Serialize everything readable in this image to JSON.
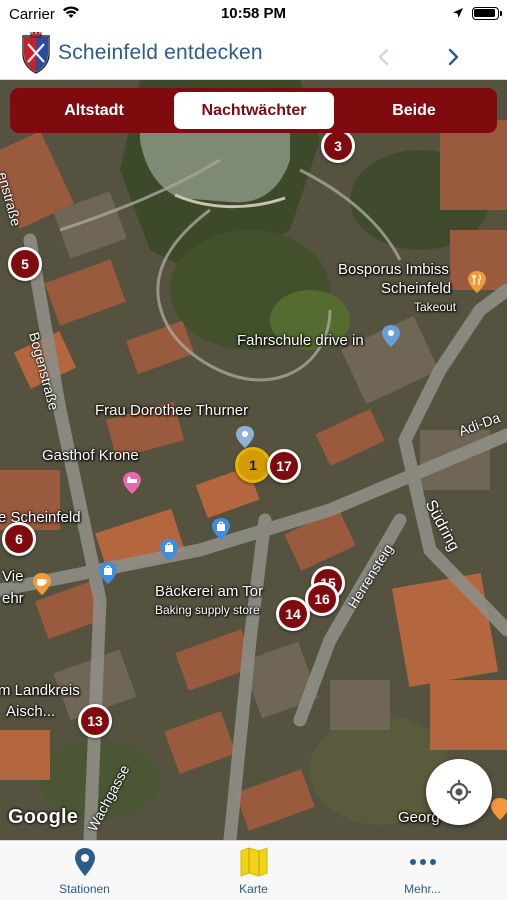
{
  "status_bar": {
    "carrier": "Carrier",
    "time": "10:58 PM"
  },
  "nav": {
    "title": "Scheinfeld entdecken"
  },
  "segments": [
    {
      "label": "Altstadt",
      "selected": false
    },
    {
      "label": "Nachtwächter",
      "selected": true
    },
    {
      "label": "Beide",
      "selected": false
    }
  ],
  "markers": [
    "3",
    "5",
    "1",
    "17",
    "6",
    "15",
    "16",
    "14",
    "13"
  ],
  "map_labels": {
    "bosporus_1": "Bosporus Imbiss",
    "bosporus_2": "Scheinfeld",
    "bosporus_takeout": "Takeout",
    "fahrschule": "Fahrschule drive in",
    "thurner": "Frau Dorothee Thurner",
    "gasthof": "Gasthof Krone",
    "scheinfeld_left": "e Scheinfeld",
    "vie": "Vie",
    "ehr": "ehr",
    "baeckerei": "Bäckerei am Tor",
    "baking": "Baking supply store",
    "landkreis_1": "m Landkreis",
    "landkreis_2": "Aisch...",
    "georg": "Georg"
  },
  "streets": {
    "enstrasse": "enstraße",
    "bogenstrasse": "Bogenstraße",
    "adi": "Adi-Da",
    "suedring": "Südring",
    "herrensteig": "Herrensteig",
    "wachgasse": "Wachgasse"
  },
  "map_attribution": "Google",
  "tabs": [
    {
      "label": "Stationen",
      "icon": "map-pin-icon"
    },
    {
      "label": "Karte",
      "icon": "folded-map-icon"
    },
    {
      "label": "Mehr...",
      "icon": "more-dots-icon"
    }
  ],
  "colors": {
    "brand_red": "#7f0b0e",
    "accent_blue": "#2b5c8a",
    "active_marker": "#d29b00"
  }
}
